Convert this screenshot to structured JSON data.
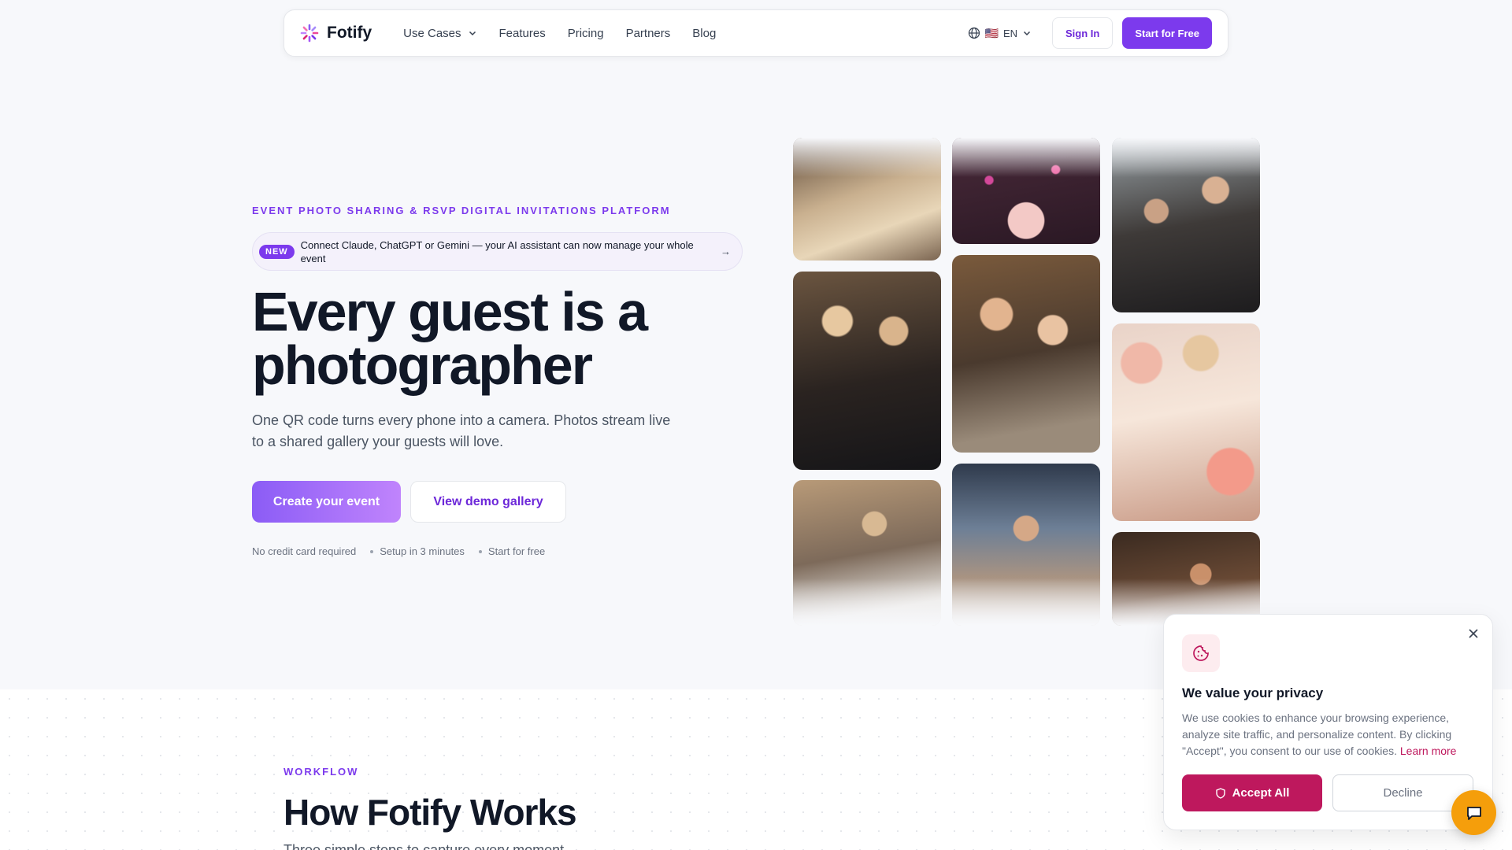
{
  "nav": {
    "logo_text": "Fotify",
    "links": [
      {
        "label": "Use Cases",
        "has_dropdown": true
      },
      {
        "label": "Features"
      },
      {
        "label": "Pricing"
      },
      {
        "label": "Partners"
      },
      {
        "label": "Blog"
      }
    ],
    "language": {
      "flag": "🇺🇸",
      "code": "EN"
    },
    "signin_label": "Sign In",
    "start_label": "Start for Free"
  },
  "hero": {
    "eyebrow": "EVENT PHOTO SHARING & RSVP DIGITAL INVITATIONS PLATFORM",
    "announcement": {
      "badge": "NEW",
      "text": "Connect Claude, ChatGPT or Gemini — your AI assistant can now manage your whole event",
      "arrow": "→"
    },
    "headline": "Every guest is a photographer",
    "subheadline": "One QR code turns every phone into a camera. Photos stream live to a shared gallery your guests will love.",
    "primary_cta": "Create your event",
    "secondary_cta": "View demo gallery",
    "meta": [
      "No credit card required",
      "Setup in 3 minutes",
      "Start for free"
    ]
  },
  "gallery": {
    "photos": [
      {
        "name": "bride-dress-dance",
        "icon": "photo-dress"
      },
      {
        "name": "grooms-embrace",
        "icon": "photo-couple"
      },
      {
        "name": "wedding-first-dance",
        "icon": "photo-dance"
      },
      {
        "name": "birthday-cake-confetti",
        "icon": "photo-cake"
      },
      {
        "name": "friends-laughing-wine",
        "icon": "photo-friends"
      },
      {
        "name": "rooftop-party-dancer",
        "icon": "photo-party"
      },
      {
        "name": "cocktail-conversation",
        "icon": "photo-cocktail"
      },
      {
        "name": "balloon-decor-room",
        "icon": "photo-balloons"
      },
      {
        "name": "evening-toast",
        "icon": "photo-toast"
      }
    ]
  },
  "workflow": {
    "eyebrow": "WORKFLOW",
    "title": "How Fotify Works",
    "subtitle": "Three simple steps to capture every moment"
  },
  "cookie": {
    "title": "We value your privacy",
    "text": "We use cookies to enhance your browsing experience, analyze site traffic, and personalize content. By clicking \"Accept\", you consent to our use of cookies.",
    "link": "Learn more",
    "accept": "Accept All",
    "decline": "Decline"
  },
  "colors": {
    "brand": "#7c3aed",
    "cookie_accent": "#be185d",
    "chat": "#f59e0b"
  }
}
